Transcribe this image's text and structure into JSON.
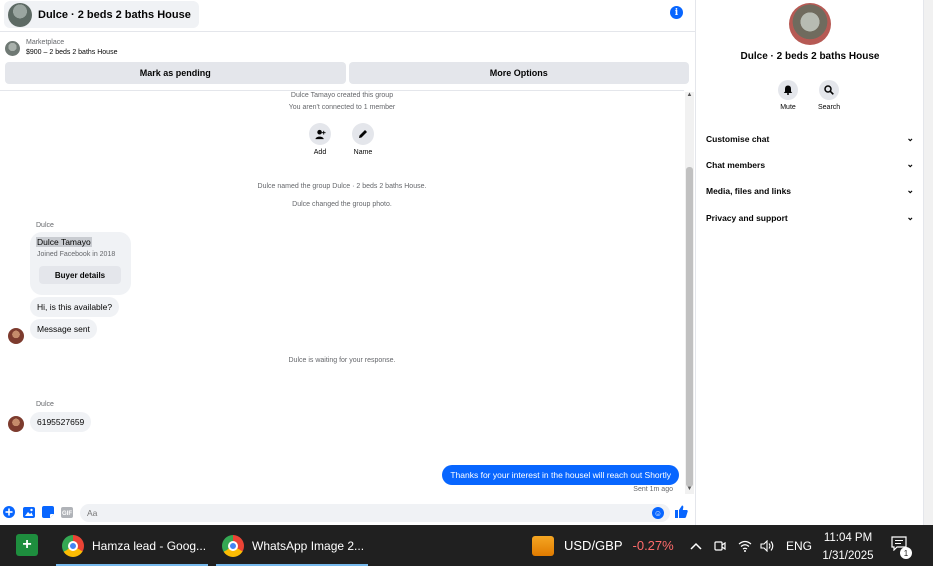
{
  "header": {
    "title": "Dulce · 2 beds 2 baths House",
    "info_icon": "info-icon"
  },
  "listing": {
    "label": "Marketplace",
    "subtitle": "$900 – 2 beds 2 baths House"
  },
  "buttons": {
    "mark_pending": "Mark as pending",
    "more_options": "More Options"
  },
  "system_messages": {
    "created": "Dulce Tamayo created this group",
    "not_connected": "You aren't connected to 1 member",
    "named": "Dulce named the group Dulce · 2 beds 2 baths House.",
    "photo": "Dulce changed the group photo.",
    "waiting": "Dulce is waiting for your response."
  },
  "group_actions": [
    {
      "label": "Add",
      "icon": "add-person-icon"
    },
    {
      "label": "Name",
      "icon": "pencil-icon"
    }
  ],
  "messages": {
    "sender_1": "Dulce",
    "card_name": "Dulce Tamayo",
    "card_joined": "Joined Facebook in 2018",
    "card_button": "Buyer details",
    "msg_available": "Hi, is this available?",
    "msg_sent": "Message sent",
    "sender_2": "Dulce",
    "msg_phone": "6195527659",
    "outgoing": "Thanks for your interest in the housel will reach out Shortly",
    "status": "Sent 1m ago"
  },
  "composer": {
    "placeholder": "Aa"
  },
  "panel": {
    "title": "Dulce · 2 beds 2 baths House",
    "actions": [
      {
        "label": "Mute",
        "icon": "bell-icon"
      },
      {
        "label": "Search",
        "icon": "search-icon"
      }
    ],
    "sections": [
      "Customise chat",
      "Chat members",
      "Media, files and links",
      "Privacy and support"
    ]
  },
  "taskbar": {
    "app1": "Hamza lead - Goog...",
    "app2": "WhatsApp Image 2...",
    "stock_label": "USD/GBP",
    "stock_change": "-0.27%",
    "language": "ENG",
    "time": "11:04 PM",
    "date": "1/31/2025",
    "notifications": "1"
  },
  "colors": {
    "accent": "#0866ff",
    "taskbar": "#202020"
  }
}
